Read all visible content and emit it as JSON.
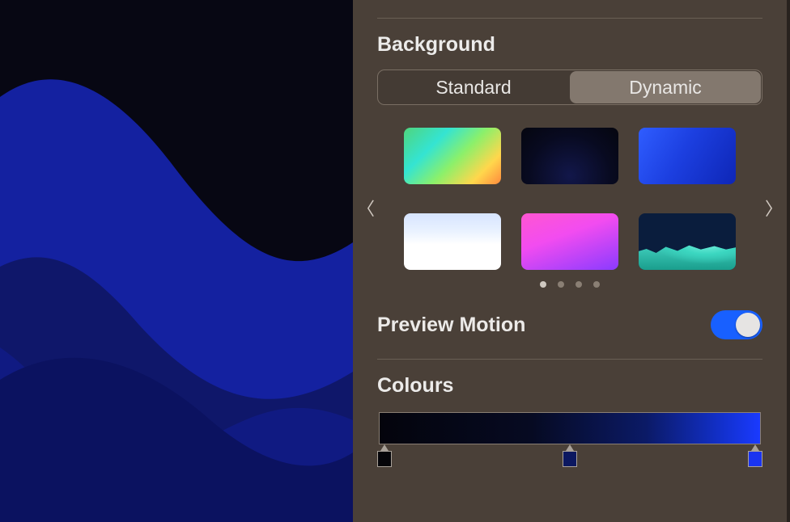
{
  "background": {
    "title": "Background",
    "segments": {
      "standard": "Standard",
      "dynamic": "Dynamic"
    },
    "selected_segment": "dynamic",
    "thumbs": [
      {
        "id": "rainbow-gradient"
      },
      {
        "id": "dark-blue-clouds"
      },
      {
        "id": "vivid-blue"
      },
      {
        "id": "white-sky"
      },
      {
        "id": "pink-purple-gradient"
      },
      {
        "id": "teal-mountains"
      }
    ],
    "pages": {
      "count": 4,
      "active": 0
    }
  },
  "preview_motion": {
    "label": "Preview Motion",
    "enabled": true
  },
  "colours": {
    "title": "Colours",
    "stops": [
      {
        "pos": 0.0,
        "hex": "#050509"
      },
      {
        "pos": 0.5,
        "hex": "#0c1860"
      },
      {
        "pos": 1.0,
        "hex": "#1a34f0"
      }
    ]
  }
}
